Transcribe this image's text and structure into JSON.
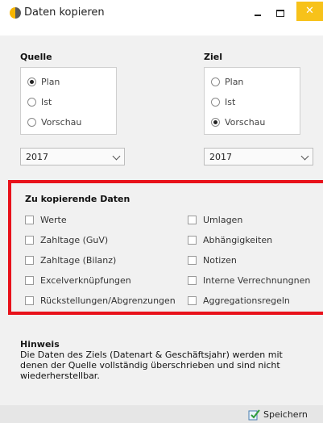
{
  "window": {
    "title": "Daten kopieren",
    "close_glyph": "✕",
    "accent_color": "#f7c21a"
  },
  "source": {
    "label": "Quelle",
    "options": [
      "Plan",
      "Ist",
      "Vorschau"
    ],
    "selected": "Plan",
    "year": "2017"
  },
  "target": {
    "label": "Ziel",
    "options": [
      "Plan",
      "Ist",
      "Vorschau"
    ],
    "selected": "Vorschau",
    "year": "2017"
  },
  "data_to_copy": {
    "label": "Zu kopierende Daten",
    "highlight_color": "#e8121b",
    "left_items": [
      "Werte",
      "Zahltage (GuV)",
      "Zahltage (Bilanz)",
      "Excelverknüpfungen",
      "Rückstellungen/Abgrenzungen"
    ],
    "right_items": [
      "Umlagen",
      "Abhängigkeiten",
      "Notizen",
      "Interne Verrechnungnen",
      "Aggregationsregeln"
    ]
  },
  "hint": {
    "title": "Hinweis",
    "text": "Die Daten des Ziels (Datenart & Geschäftsjahr) werden mit denen der Quelle vollständig überschrieben und sind nicht wiederherstellbar."
  },
  "footer": {
    "save_label": "Speichern"
  }
}
